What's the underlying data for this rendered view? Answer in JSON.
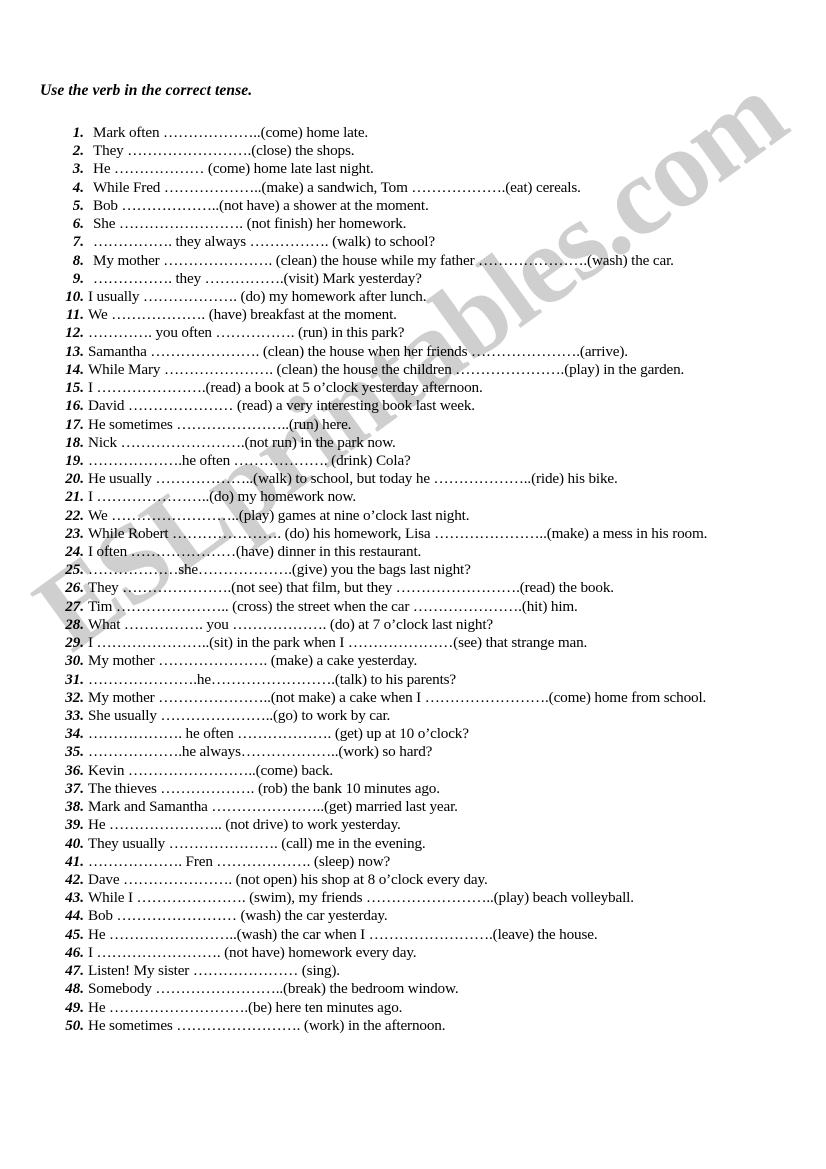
{
  "document": {
    "title": "Use the verb in the correct tense.",
    "watermark": "ESLprintables.com",
    "watermark_color": "#cfcfcf"
  },
  "exercises": [
    {
      "number": "1.",
      "text": "Mark often ………………..(come) home late."
    },
    {
      "number": "2.",
      "text": "They …………………….(close) the shops."
    },
    {
      "number": "3.",
      "text": "He ……………… (come) home late last night."
    },
    {
      "number": "4.",
      "text": "While Fred ………………..(make) a sandwich, Tom ……………….(eat) cereals."
    },
    {
      "number": "5.",
      "text": "Bob ………………..(not have) a shower at the moment."
    },
    {
      "number": "6.",
      "text": "She ……………………. (not finish) her homework."
    },
    {
      "number": "7.",
      "text": "……………. they always ……………. (walk) to school?"
    },
    {
      "number": "8.",
      "text": "My mother …………………. (clean) the house while my father ………………….(wash) the car."
    },
    {
      "number": "9.",
      "text": "……………. they …………….(visit) Mark yesterday?"
    },
    {
      "number": "10.",
      "text": "I usually ………………. (do) my homework after lunch."
    },
    {
      "number": "11.",
      "text": "We ………………. (have) breakfast at the moment."
    },
    {
      "number": "12.",
      "text": "…………. you often ……………. (run) in this park?"
    },
    {
      "number": "13.",
      "text": "Samantha …………………. (clean) the house when her friends ………………….(arrive)."
    },
    {
      "number": "14.",
      "text": "While Mary …………………. (clean) the house the children ………………….(play) in the garden."
    },
    {
      "number": "15.",
      "text": "I ………………….(read) a book at 5 o’clock yesterday afternoon."
    },
    {
      "number": "16.",
      "text": "David ………………… (read) a very interesting book last week."
    },
    {
      "number": "17.",
      "text": "He sometimes …………………..(run) here."
    },
    {
      "number": "18.",
      "text": "Nick …………………….(not run) in the park now."
    },
    {
      "number": "19.",
      "text": "……………….he often ………………. (drink) Cola?"
    },
    {
      "number": "20.",
      "text": "He usually ………………..(walk) to school, but today he ………………..(ride) his bike."
    },
    {
      "number": "21.",
      "text": "I …………………..(do) my homework now."
    },
    {
      "number": "22.",
      "text": "We ……………………..(play) games at nine o’clock last night."
    },
    {
      "number": "23.",
      "text": "While Robert …………………. (do) his homework, Lisa …………………..(make) a mess in his room."
    },
    {
      "number": "24.",
      "text": "I often …………………(have) dinner in this restaurant."
    },
    {
      "number": "25.",
      "text": "………………she……………….(give) you the bags last night?"
    },
    {
      "number": "26.",
      "text": "They ………………….(not see) that film, but they …………………….(read) the book."
    },
    {
      "number": "27.",
      "text": "Tim ………………….. (cross) the street when the car ………………….(hit) him."
    },
    {
      "number": "28.",
      "text": "What ……………. you ………………. (do) at 7 o’clock last night?"
    },
    {
      "number": "29.",
      "text": "I …………………..(sit) in the park when I …………………(see) that strange man."
    },
    {
      "number": "30.",
      "text": "My mother …………………. (make) a cake yesterday."
    },
    {
      "number": "31.",
      "text": "………………….he…………………….(talk) to his parents?"
    },
    {
      "number": "32.",
      "text": "My mother …………………..(not make) a cake when I …………………….(come) home from school."
    },
    {
      "number": "33.",
      "text": "She usually …………………..(go) to work by car."
    },
    {
      "number": "34.",
      "text": "………………. he often ………………. (get) up at 10 o’clock?"
    },
    {
      "number": "35.",
      "text": "……………….he always………………..(work) so hard?"
    },
    {
      "number": "36.",
      "text": "Kevin ……………………..(come) back."
    },
    {
      "number": "37.",
      "text": "The thieves ………………. (rob) the bank 10 minutes ago."
    },
    {
      "number": "38.",
      "text": "Mark and Samantha …………………..(get) married last year."
    },
    {
      "number": "39.",
      "text": "He ………………….. (not drive) to work yesterday."
    },
    {
      "number": "40.",
      "text": "They usually …………………. (call) me in the evening."
    },
    {
      "number": "41.",
      "text": "………………. Fren ………………. (sleep) now?"
    },
    {
      "number": "42.",
      "text": "Dave  …………………. (not open) his shop at 8 o’clock every day."
    },
    {
      "number": "43.",
      "text": "While I …………………. (swim), my friends ……………………..(play) beach volleyball."
    },
    {
      "number": "44.",
      "text": "Bob …………………… (wash) the car yesterday."
    },
    {
      "number": "45.",
      "text": "He ……………………..(wash) the car when I …………………….(leave) the house."
    },
    {
      "number": "46.",
      "text": "I ……………………. (not have) homework every day."
    },
    {
      "number": "47.",
      "text": "Listen! My sister ………………… (sing)."
    },
    {
      "number": "48.",
      "text": "Somebody ……………………..(break) the bedroom window."
    },
    {
      "number": "49.",
      "text": "He ……………………….(be) here ten minutes ago."
    },
    {
      "number": "50.",
      "text": "He sometimes ……………………. (work) in the afternoon."
    }
  ]
}
